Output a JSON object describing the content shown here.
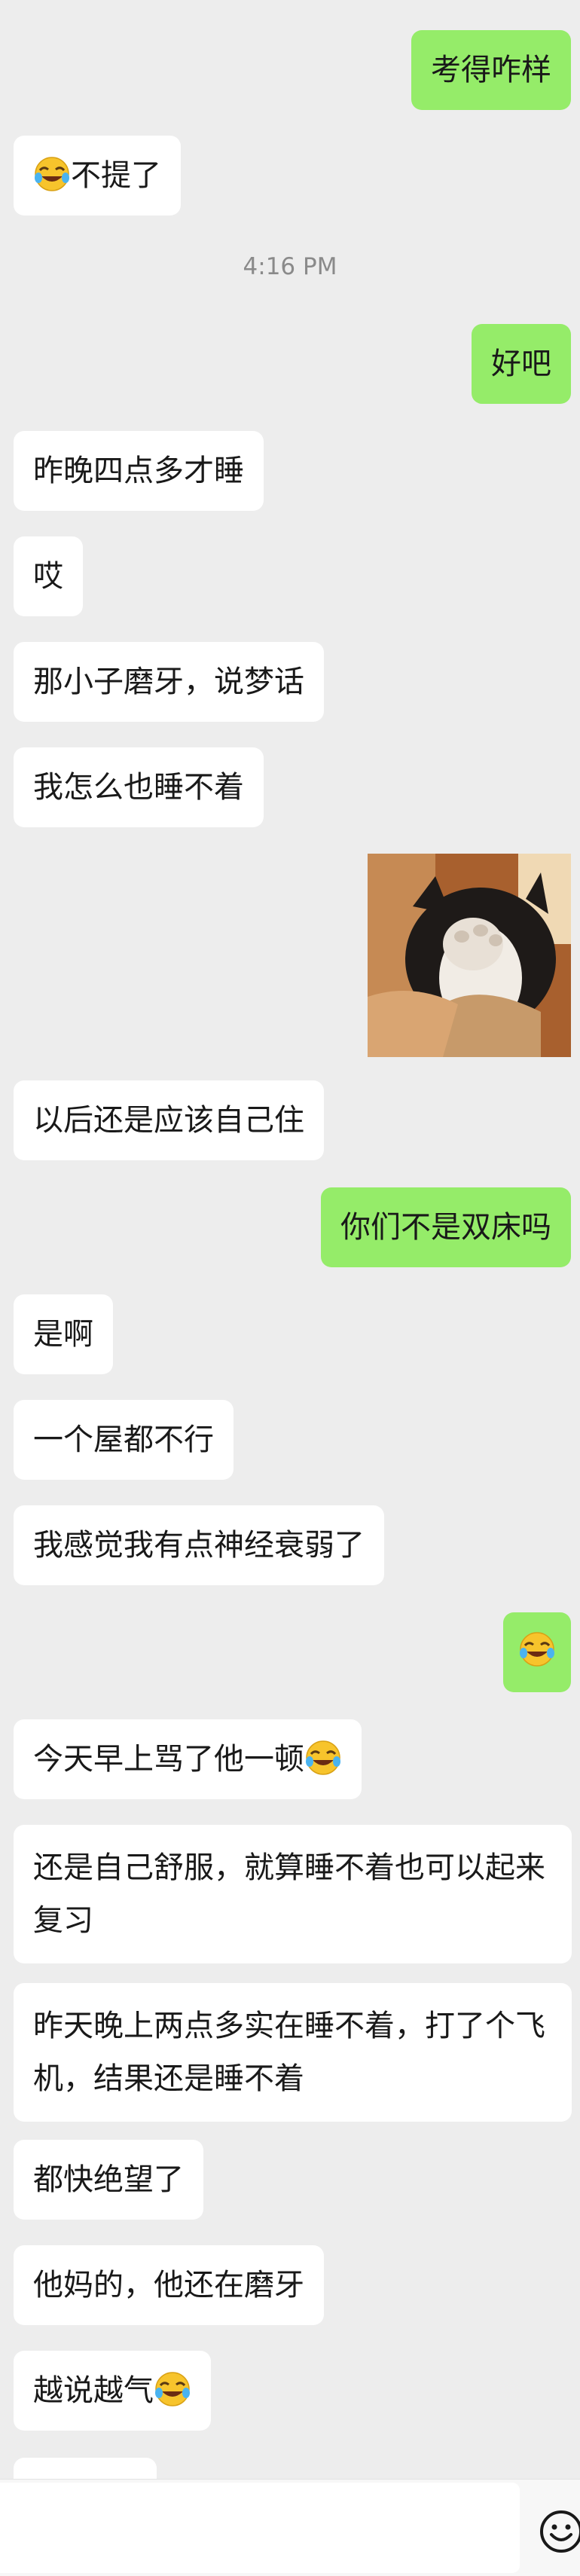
{
  "messages": {
    "m1": "考得咋样",
    "m2": "不提了",
    "timestamp": "4:16 PM",
    "m3": "好吧",
    "m4": "昨晚四点多才睡",
    "m5": "哎",
    "m6": "那小子磨牙，说梦话",
    "m7": "我怎么也睡不着",
    "m8": "以后还是应该自己住",
    "m9": "你们不是双床吗",
    "m10": "是啊",
    "m11": "一个屋都不行",
    "m12": "我感觉我有点神经衰弱了",
    "m14": "今天早上骂了他一顿",
    "m15": "还是自己舒服，就算睡不着也可以起来复习",
    "m16": "昨天晚上两点多实在睡不着，打了个飞机，结果还是睡不着",
    "m17": "都快绝望了",
    "m18": "他妈的，他还在磨牙",
    "m19": "越说越气"
  },
  "icons": {
    "emoji": "face-with-tears-of-joy-icon",
    "input_emoji": "smiley-face-icon"
  },
  "colors": {
    "background": "#ededed",
    "incoming_bubble": "#ffffff",
    "outgoing_bubble": "#95ec69"
  }
}
